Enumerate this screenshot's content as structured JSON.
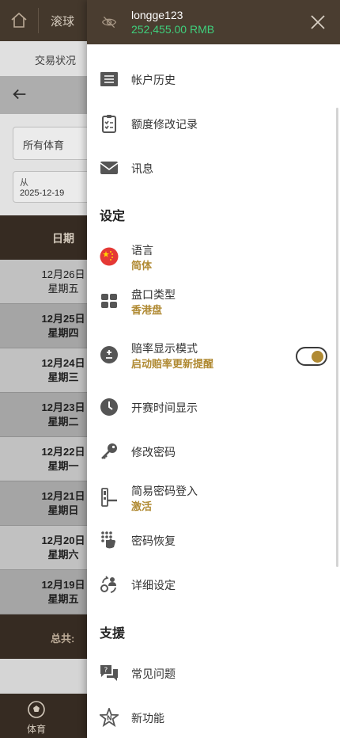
{
  "background": {
    "top_tab_live": "滚球",
    "sub_tab": "交易状况",
    "sport_filter": "所有体育",
    "date_from_label": "从",
    "date_from_value": "2025-12-19",
    "table_header_date": "日期",
    "rows": [
      {
        "date": "12月26日",
        "weekday": "星期五",
        "bold": false
      },
      {
        "date": "12月25日",
        "weekday": "星期四",
        "bold": true
      },
      {
        "date": "12月24日",
        "weekday": "星期三",
        "bold": true
      },
      {
        "date": "12月23日",
        "weekday": "星期二",
        "bold": true
      },
      {
        "date": "12月22日",
        "weekday": "星期一",
        "bold": true
      },
      {
        "date": "12月21日",
        "weekday": "星期日",
        "bold": true
      },
      {
        "date": "12月20日",
        "weekday": "星期六",
        "bold": true
      },
      {
        "date": "12月19日",
        "weekday": "星期五",
        "bold": true
      }
    ],
    "total_label": "总共:",
    "bottom_nav_sport": "体育"
  },
  "drawer": {
    "username": "longge123",
    "balance": "252,455.00  RMB",
    "account_history": "帐户历史",
    "credit_change_log": "额度修改记录",
    "messages": "讯息",
    "settings_header": "设定",
    "language_label": "语言",
    "language_value": "简体",
    "odds_type_label": "盘口类型",
    "odds_type_value": "香港盘",
    "odds_display_label": "赔率显示模式",
    "odds_display_value": "启动赔率更新提醒",
    "odds_display_toggle_on": true,
    "kickoff_time_display": "开赛时间显示",
    "change_password": "修改密码",
    "easy_login_label": "简易密码登入",
    "easy_login_value": "激活",
    "password_recovery": "密码恢复",
    "detail_settings": "详细设定",
    "support_header": "支援",
    "faq": "常见问题",
    "new_features": "新功能"
  },
  "colors": {
    "header_brown": "#4a3d30",
    "balance_green": "#3fcf7c",
    "accent_gold": "#b08a33",
    "dark_row": "#3b2f25"
  },
  "icons": [
    "home-icon",
    "back-arrow-icon",
    "eye-off-icon",
    "close-icon",
    "list-icon",
    "clipboard-check-icon",
    "envelope-icon",
    "china-flag-icon",
    "grid-icon",
    "plus-minus-icon",
    "clock-icon",
    "key-icon",
    "door-lock-icon",
    "fingerprint-keypad-icon",
    "gear-user-icon",
    "question-chat-icon",
    "star-icon",
    "soccer-ball-icon"
  ]
}
